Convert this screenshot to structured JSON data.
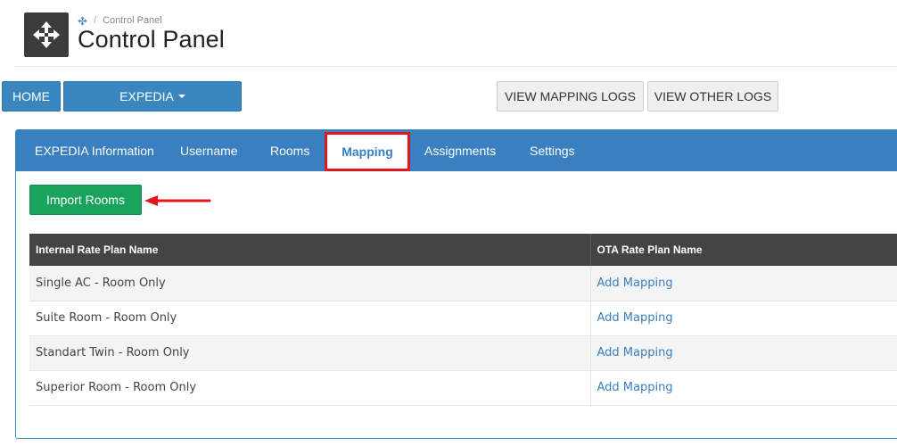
{
  "header": {
    "breadcrumb": "Control Panel",
    "title": "Control Panel"
  },
  "toolbar": {
    "home_label": "HOME",
    "expedia_label": "EXPEDIA",
    "view_mapping_logs_label": "VIEW MAPPING LOGS",
    "view_other_logs_label": "VIEW OTHER LOGS"
  },
  "tabs": [
    {
      "label": "EXPEDIA Information"
    },
    {
      "label": "Username"
    },
    {
      "label": "Rooms"
    },
    {
      "label": "Mapping",
      "active": true
    },
    {
      "label": "Assignments"
    },
    {
      "label": "Settings"
    }
  ],
  "import_button_label": "Import Rooms",
  "table": {
    "headers": [
      "Internal Rate Plan Name",
      "OTA Rate Plan Name"
    ],
    "rows": [
      {
        "internal": "Single AC - Room Only",
        "ota_action": "Add Mapping"
      },
      {
        "internal": "Suite Room - Room Only",
        "ota_action": "Add Mapping"
      },
      {
        "internal": "Standart Twin - Room Only",
        "ota_action": "Add Mapping"
      },
      {
        "internal": "Superior Room - Room Only",
        "ota_action": "Add Mapping"
      }
    ]
  },
  "colors": {
    "primary": "#3a7fbf",
    "success": "#1aa35b",
    "highlight": "#e3161e",
    "table_header": "#444444"
  },
  "icons": {
    "app": "move-arrows-icon",
    "breadcrumb": "move-arrows-icon",
    "annotation": "arrow-left-icon"
  }
}
